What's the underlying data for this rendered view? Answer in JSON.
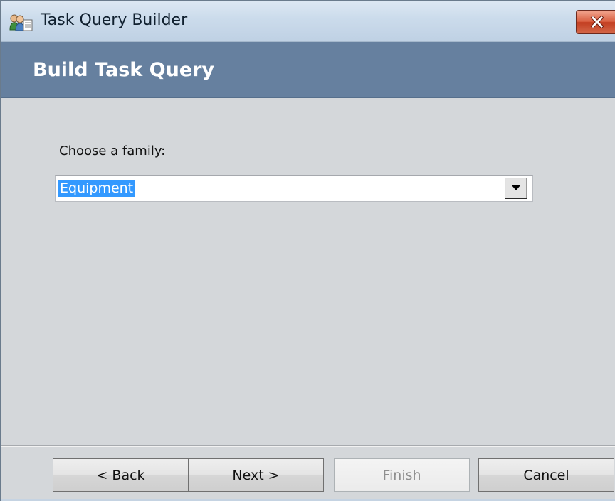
{
  "window": {
    "title": "Task Query Builder",
    "icon": "people-document-icon",
    "close_icon": "close-icon"
  },
  "header": {
    "title": "Build Task Query"
  },
  "main": {
    "family_label": "Choose a family:",
    "family_select": {
      "value": "Equipment",
      "dropdown_icon": "chevron-down-icon"
    }
  },
  "buttons": {
    "back": "< Back",
    "next": "Next >",
    "finish": "Finish",
    "cancel": "Cancel"
  },
  "colors": {
    "header_band": "#66809f",
    "selection": "#3399ff",
    "close_button": "#c94a2d",
    "dialog_background": "#d4d7da"
  }
}
